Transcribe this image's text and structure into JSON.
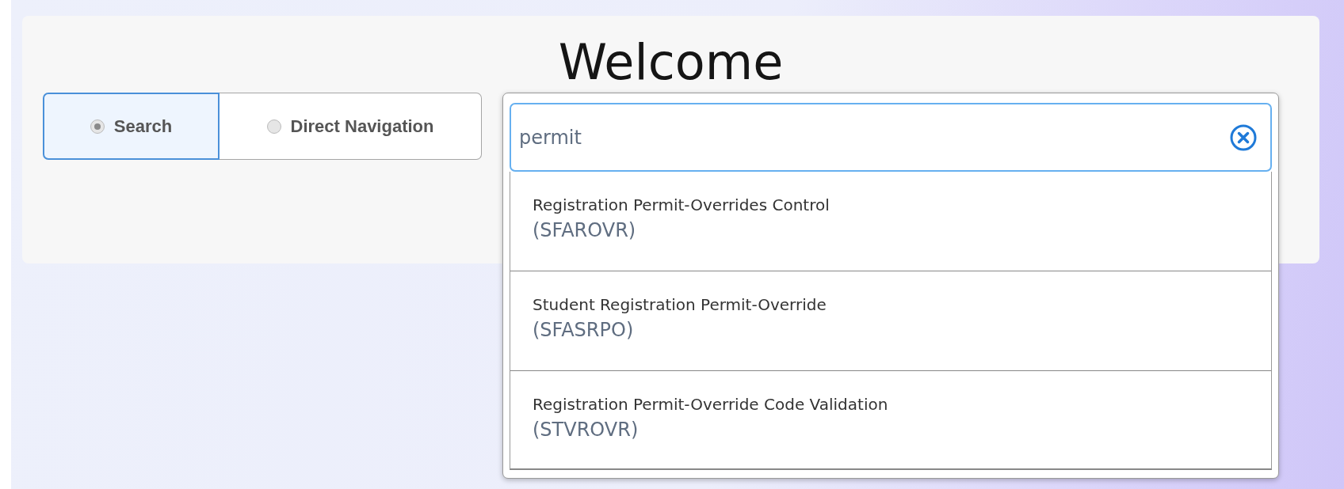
{
  "title": "Welcome",
  "modes": [
    {
      "label": "Search",
      "selected": true
    },
    {
      "label": "Direct Navigation",
      "selected": false
    }
  ],
  "search": {
    "value": "permit"
  },
  "results": [
    {
      "name": "Registration Permit-Overrides Control",
      "code": "(SFAROVR)"
    },
    {
      "name": "Student Registration Permit-Override",
      "code": "(SFASRPO)"
    },
    {
      "name": "Registration Permit-Override Code Validation",
      "code": "(STVROVR)"
    }
  ]
}
